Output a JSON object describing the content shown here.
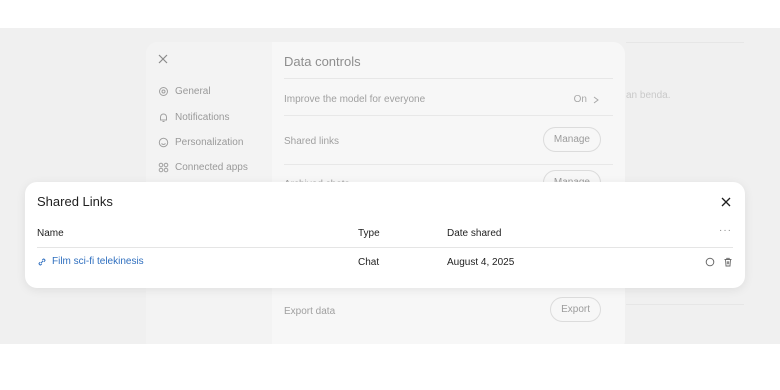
{
  "background": {
    "partial_text": "an benda."
  },
  "settings": {
    "nav": [
      {
        "label": "General",
        "icon": "gear-icon"
      },
      {
        "label": "Notifications",
        "icon": "bell-icon"
      },
      {
        "label": "Personalization",
        "icon": "personalization-icon"
      },
      {
        "label": "Connected apps",
        "icon": "apps-icon"
      }
    ],
    "title": "Data controls",
    "rows": {
      "improve_label": "Improve the model for everyone",
      "improve_value": "On",
      "shared_label": "Shared links",
      "shared_button": "Manage",
      "archived_label": "Archived chats",
      "archived_button": "Manage",
      "export_label": "Export data",
      "export_button": "Export"
    }
  },
  "modal": {
    "title": "Shared Links",
    "columns": {
      "name": "Name",
      "type": "Type",
      "date": "Date shared",
      "more": "···"
    },
    "rows": [
      {
        "name": "Film sci-fi telekinesis",
        "type": "Chat",
        "date": "August 4, 2025"
      }
    ]
  },
  "colors": {
    "link": "#2f6fbf",
    "overlay": "#f0f0f0"
  }
}
